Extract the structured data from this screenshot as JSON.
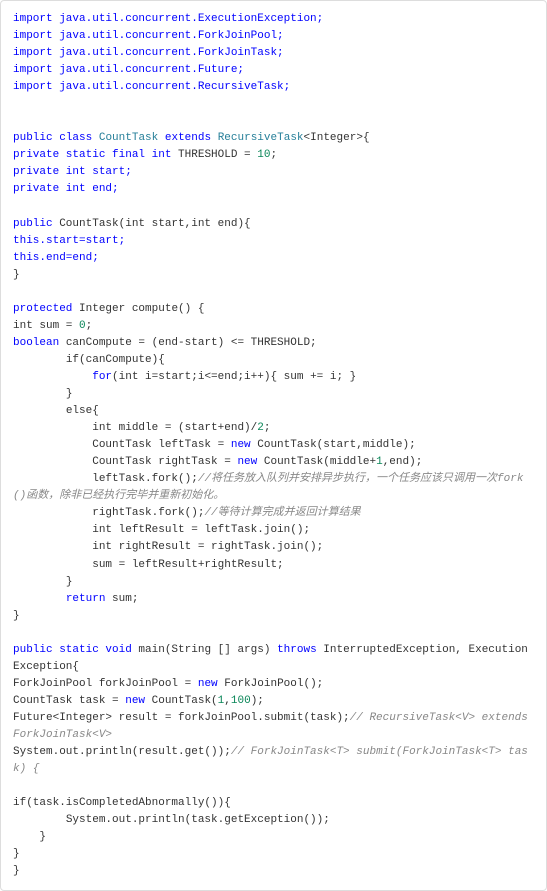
{
  "code": {
    "imports": [
      "import java.util.concurrent.ExecutionException;",
      "import java.util.concurrent.ForkJoinPool;",
      "import java.util.concurrent.ForkJoinTask;",
      "import java.util.concurrent.Future;",
      "import java.util.concurrent.RecursiveTask;"
    ],
    "classDecl": {
      "kw_public": "public",
      "kw_class": "class",
      "className": "CountTask",
      "kw_extends": "extends",
      "superClass": "RecursiveTask",
      "generic": "<Integer>{"
    },
    "thresholdLine": {
      "prefix": "private static final int",
      "name": " THRESHOLD = ",
      "value": "10",
      "suffix": ";"
    },
    "startField": "private int start;",
    "endField": "private int end;",
    "ctorSig": {
      "kw": "public",
      "rest": " CountTask(int start,int end){"
    },
    "ctorBody1": "this.start=start;",
    "ctorBody2": "this.end=end;",
    "ctorClose": "}",
    "computeSig": {
      "kw": "protected",
      "rest": " Integer compute() {"
    },
    "sumInit": {
      "prefix": "int sum = ",
      "value": "0",
      "suffix": ";"
    },
    "canCompute": {
      "kw": "boolean",
      "rest": " canCompute = (end-start) <= THRESHOLD;"
    },
    "ifLine": "        if(canCompute){",
    "forLine": {
      "indent": "            ",
      "kw": "for",
      "rest": "(int i=start;i<=end;i++){ sum += i; }"
    },
    "closeIf": "        }",
    "elseLine": "        else{",
    "middleLine": {
      "indent": "            int middle = (start+end)/",
      "num": "2",
      "suffix": ";"
    },
    "leftTask": {
      "indent": "            CountTask leftTask = ",
      "kw": "new",
      "rest": " CountTask(start,middle);"
    },
    "rightTask": {
      "indent": "            CountTask rightTask = ",
      "kw": "new",
      "mid": " CountTask(middle+",
      "num": "1",
      "suffix": ",end);"
    },
    "leftFork": {
      "code": "            leftTask.fork();",
      "comment": "//将任务放入队列并安排异步执行，一个任务应该只调用一次fork()函数，除非已经执行完毕并重新初始化。"
    },
    "rightFork": {
      "code": "            rightTask.fork();",
      "comment": "//等待计算完成并返回计算结果"
    },
    "leftResult": "            int leftResult = leftTask.join();",
    "rightResult": "            int rightResult = rightTask.join();",
    "sumAssign": "            sum = leftResult+rightResult;",
    "closeElse": "        }",
    "returnLine": {
      "indent": "        ",
      "kw": "return",
      "rest": " sum;"
    },
    "computeClose": "}",
    "mainSig": {
      "p1": "public static void",
      "p2": " main(String [] args) ",
      "p3": "throws",
      "p4": " InterruptedException, ExecutionException{"
    },
    "poolLine": {
      "prefix": "ForkJoinPool forkJoinPool = ",
      "kw": "new",
      "rest": " ForkJoinPool();"
    },
    "taskLine": {
      "prefix": "CountTask task = ",
      "kw": "new",
      "mid": " CountTask(",
      "n1": "1",
      "comma": ",",
      "n2": "100",
      "suffix": ");"
    },
    "submitLine": {
      "code": "Future<Integer> result = forkJoinPool.submit(task);",
      "comment": "// RecursiveTask<V> extends ForkJoinTask<V>"
    },
    "printlnLine": {
      "code": "System.out.println(result.get());",
      "comment": "// ForkJoinTask<T> submit(ForkJoinTask<T> task) {"
    },
    "ifAbnormal": "if(task.isCompletedAbnormally()){",
    "printException": "        System.out.println(task.getException());",
    "closeIfAbnormal": "    }",
    "mainClose": "}",
    "classClose": "}"
  }
}
